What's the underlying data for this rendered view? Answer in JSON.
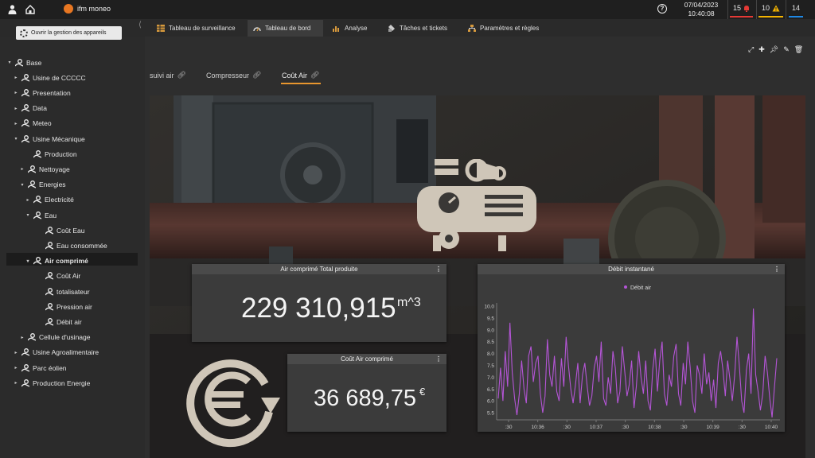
{
  "header": {
    "brand": "ifm moneo",
    "date": "07/04/2023",
    "time": "10:40:08",
    "help": "?",
    "alarms": [
      {
        "count": "15",
        "color": "#e53935"
      },
      {
        "count": "10",
        "color": "#f4b400"
      },
      {
        "count": "14",
        "color": "#1e88e5"
      }
    ]
  },
  "manage_button": "Ouvrir la gestion des appareils",
  "tabs": [
    {
      "label": "Tableau de surveillance",
      "icon": "table-icon"
    },
    {
      "label": "Tableau de bord",
      "icon": "gauge-icon"
    },
    {
      "label": "Analyse",
      "icon": "chart-icon"
    },
    {
      "label": "Tâches et tickets",
      "icon": "ticket-icon"
    },
    {
      "label": "Paramètres et règles",
      "icon": "network-icon"
    }
  ],
  "tree": [
    {
      "label": "Base",
      "arrow": "▾"
    },
    {
      "label": "Usine de CCCCC",
      "arrow": "▸"
    },
    {
      "label": "Presentation",
      "arrow": "▸"
    },
    {
      "label": "Data",
      "arrow": "▸"
    },
    {
      "label": "Meteo",
      "arrow": "▸"
    },
    {
      "label": "Usine Mécanique",
      "arrow": "▾"
    },
    {
      "label": "Production",
      "arrow": ""
    },
    {
      "label": "Nettoyage",
      "arrow": "▸"
    },
    {
      "label": "Energies",
      "arrow": "▾"
    },
    {
      "label": "Electricité",
      "arrow": "▸"
    },
    {
      "label": "Eau",
      "arrow": "▾"
    },
    {
      "label": "Coût Eau",
      "arrow": ""
    },
    {
      "label": "Eau consommée",
      "arrow": ""
    },
    {
      "label": "Air comprimé",
      "arrow": "▾"
    },
    {
      "label": "Coût Air",
      "arrow": ""
    },
    {
      "label": "totalisateur",
      "arrow": ""
    },
    {
      "label": "Pression air",
      "arrow": ""
    },
    {
      "label": "Débit air",
      "arrow": ""
    },
    {
      "label": "Cellule d'usinage",
      "arrow": "▸"
    },
    {
      "label": "Usine Agroalimentaire",
      "arrow": "▸"
    },
    {
      "label": "Parc éolien",
      "arrow": "▸"
    },
    {
      "label": "Production Energie",
      "arrow": "▸"
    }
  ],
  "dashboard_tabs": [
    {
      "label": "suivi air"
    },
    {
      "label": "Compresseur"
    },
    {
      "label": "Coût Air"
    }
  ],
  "widgets": {
    "total": {
      "title": "Air comprimé Total produite",
      "value": "229 310,915",
      "unit": "m^3"
    },
    "cost": {
      "title": "Coût Air comprimé",
      "value": "36 689,75",
      "unit": "€"
    },
    "flow": {
      "title": "Débit instantané",
      "menu": "⋮"
    }
  },
  "chart_data": {
    "type": "line",
    "series": [
      {
        "name": "Débit air",
        "color": "#b455d6"
      }
    ],
    "ylim": [
      5.2,
      10.0
    ],
    "y_ticks": [
      "10.0",
      "9.5",
      "9.0",
      "8.5",
      "8.0",
      "7.5",
      "7.0",
      "6.5",
      "6.0",
      "5.5"
    ],
    "x_ticks": [
      ":30",
      "10:36",
      ":30",
      "10:37",
      ":30",
      "10:38",
      ":30",
      "10:39",
      ":30",
      "10:40"
    ],
    "values": [
      6.1,
      7.4,
      6.0,
      8.1,
      6.6,
      9.3,
      7.2,
      6.1,
      5.4,
      6.3,
      7.7,
      6.5,
      5.9,
      7.9,
      8.3,
      6.8,
      7.6,
      7.9,
      6.3,
      5.5,
      6.2,
      8.6,
      7.1,
      6.6,
      7.9,
      6.4,
      6.0,
      7.8,
      6.6,
      8.7,
      7.5,
      6.5,
      5.9,
      6.7,
      7.6,
      5.9,
      7.1,
      7.6,
      6.6,
      5.8,
      6.2,
      7.4,
      7.9,
      6.8,
      8.5,
      6.1,
      5.8,
      7.0,
      6.3,
      8.1,
      7.4,
      5.9,
      6.4,
      8.3,
      7.3,
      6.2,
      6.7,
      7.7,
      5.7,
      6.6,
      8.1,
      7.0,
      6.3,
      7.7,
      6.0,
      5.6,
      7.3,
      8.2,
      6.4,
      7.7,
      8.5,
      6.3,
      5.8,
      7.1,
      6.6,
      7.9,
      8.4,
      6.3,
      5.8,
      7.6,
      6.7,
      8.5,
      7.4,
      6.0,
      5.5,
      7.5,
      7.1,
      6.3,
      8.0,
      6.7,
      7.2,
      6.0,
      6.9,
      5.7,
      7.6,
      8.1,
      7.3,
      6.2,
      7.7,
      6.9,
      6.0,
      7.1,
      8.7,
      7.5,
      6.0,
      5.5,
      7.3,
      8.0,
      6.3,
      9.9,
      7.1,
      6.4,
      5.6,
      6.3,
      7.9,
      7.2,
      6.1,
      5.3,
      6.6,
      7.8
    ]
  }
}
